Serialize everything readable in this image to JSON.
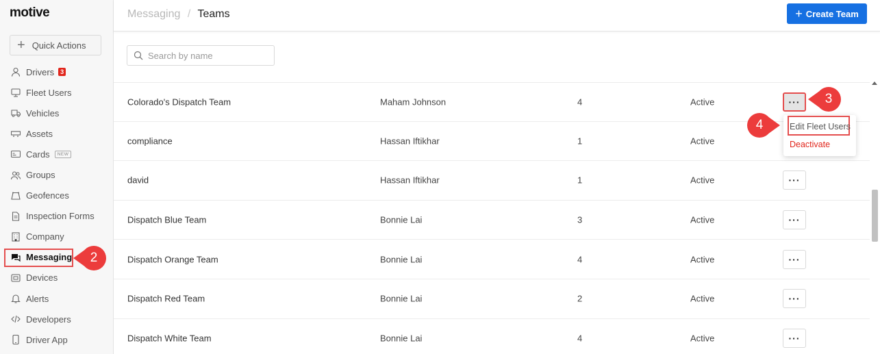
{
  "brand": {
    "logo_text": "motive"
  },
  "sidebar": {
    "quick_actions": "Quick Actions",
    "items": [
      {
        "label": "Drivers",
        "icon": "person-icon",
        "badge": "3"
      },
      {
        "label": "Fleet Users",
        "icon": "monitor-icon"
      },
      {
        "label": "Vehicles",
        "icon": "truck-icon"
      },
      {
        "label": "Assets",
        "icon": "trailer-icon"
      },
      {
        "label": "Cards",
        "icon": "card-icon",
        "tag": "NEW"
      },
      {
        "label": "Groups",
        "icon": "people-icon"
      },
      {
        "label": "Geofences",
        "icon": "geofence-icon"
      },
      {
        "label": "Inspection Forms",
        "icon": "document-icon"
      },
      {
        "label": "Company",
        "icon": "building-icon"
      },
      {
        "label": "Messaging",
        "icon": "chat-icon",
        "active": true
      },
      {
        "label": "Devices",
        "icon": "device-icon"
      },
      {
        "label": "Alerts",
        "icon": "bell-icon"
      },
      {
        "label": "Developers",
        "icon": "code-icon"
      },
      {
        "label": "Driver App",
        "icon": "phone-icon"
      }
    ]
  },
  "header": {
    "breadcrumb_parent": "Messaging",
    "breadcrumb_separator": "/",
    "breadcrumb_current": "Teams",
    "create_button": "Create Team"
  },
  "search": {
    "placeholder": "Search by name"
  },
  "table": {
    "rows": [
      {
        "name": "Colorado's Dispatch Team",
        "owner": "Maham Johnson",
        "count": "4",
        "status": "Active"
      },
      {
        "name": "compliance",
        "owner": "Hassan Iftikhar",
        "count": "1",
        "status": "Active"
      },
      {
        "name": "david",
        "owner": "Hassan Iftikhar",
        "count": "1",
        "status": "Active"
      },
      {
        "name": "Dispatch Blue Team",
        "owner": "Bonnie Lai",
        "count": "3",
        "status": "Active"
      },
      {
        "name": "Dispatch Orange Team",
        "owner": "Bonnie Lai",
        "count": "4",
        "status": "Active"
      },
      {
        "name": "Dispatch Red Team",
        "owner": "Bonnie Lai",
        "count": "2",
        "status": "Active"
      },
      {
        "name": "Dispatch White Team",
        "owner": "Bonnie Lai",
        "count": "4",
        "status": "Active"
      }
    ],
    "more_label": "···"
  },
  "dropdown": {
    "edit": "Edit Fleet Users",
    "deactivate": "Deactivate"
  },
  "callouts": {
    "c2": "2",
    "c3": "3",
    "c4": "4"
  },
  "colors": {
    "accent": "#1670e2",
    "callout": "#ec3c3c",
    "danger": "#e1261c"
  }
}
